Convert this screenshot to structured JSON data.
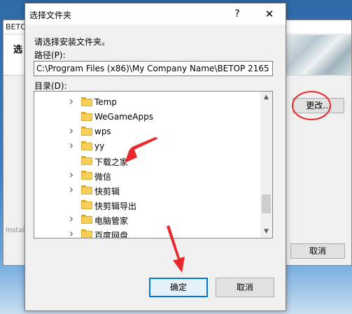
{
  "background_window": {
    "title": "BETOP",
    "header_title": "选",
    "change_button": "更改...",
    "brand_text": "Install",
    "cancel_button": "取消"
  },
  "dialog": {
    "title": "选择文件夹",
    "help_glyph": "?",
    "close_glyph": "✕",
    "instruction": "请选择安装文件夹。",
    "path_label": "路径(P):",
    "path_value": "C:\\Program Files (x86)\\My Company Name\\BETOP 2165",
    "dir_label": "目录(D):",
    "ok_button": "确定",
    "cancel_button": "取消"
  },
  "tree": {
    "items": [
      {
        "name": "Temp",
        "expandable": true
      },
      {
        "name": "WeGameApps",
        "expandable": false
      },
      {
        "name": "wps",
        "expandable": true
      },
      {
        "name": "yy",
        "expandable": true
      },
      {
        "name": "下载之家",
        "expandable": false
      },
      {
        "name": "微信",
        "expandable": true
      },
      {
        "name": "快剪辑",
        "expandable": true
      },
      {
        "name": "快剪辑导出",
        "expandable": false
      },
      {
        "name": "电脑管家",
        "expandable": true
      },
      {
        "name": "百度网盘",
        "expandable": true
      }
    ],
    "scroll_up_glyph": "▲",
    "scroll_down_glyph": "▼"
  },
  "icons": {
    "folder": "folder-icon",
    "expander": "chevron-right-icon"
  },
  "colors": {
    "accent": "#0078d7",
    "annotation": "#e8282b",
    "folder": "#f8cf56"
  }
}
